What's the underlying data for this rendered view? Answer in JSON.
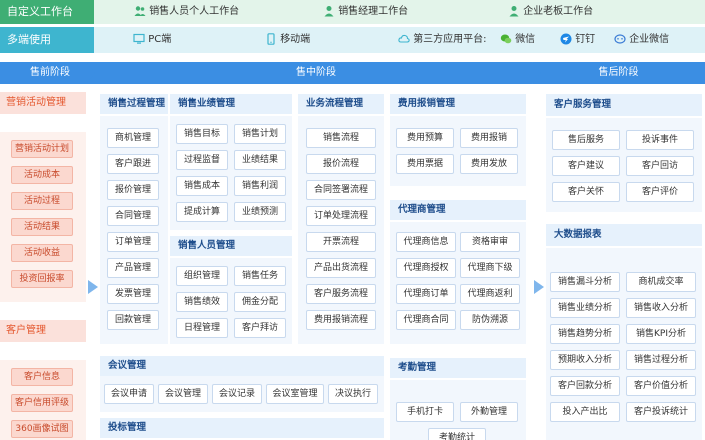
{
  "row1": {
    "label": "自定义工作台",
    "items": [
      "销售人员个人工作台",
      "销售经理工作台",
      "企业老板工作台"
    ]
  },
  "row2": {
    "label": "多端使用",
    "pc": "PC端",
    "mobile": "移动端",
    "third": "第三方应用平台:",
    "wechat": "微信",
    "dingtalk": "钉钉",
    "wework": "企业微信"
  },
  "stages": {
    "pre": "售前阶段",
    "mid": "售中阶段",
    "post": "售后阶段"
  },
  "pre": {
    "marketing": {
      "title": "营销活动管理",
      "items": [
        "营销活动计划",
        "活动成本",
        "活动过程",
        "活动结果",
        "活动收益",
        "投资回报率"
      ]
    },
    "customer": {
      "title": "客户管理",
      "items": [
        "客户信息",
        "客户信用评级",
        "360画像试图"
      ]
    }
  },
  "mid": {
    "sales_process": {
      "title": "销售过程管理",
      "items": [
        "商机管理",
        "客户跟进",
        "报价管理",
        "合同管理",
        "订单管理",
        "产品管理",
        "发票管理",
        "回款管理"
      ]
    },
    "performance": {
      "title": "销售业绩管理",
      "items": [
        "销售目标",
        "销售计划",
        "过程监督",
        "业绩结果",
        "销售成本",
        "销售利润",
        "提成计算",
        "业绩预测"
      ]
    },
    "staff": {
      "title": "销售人员管理",
      "items": [
        "组织管理",
        "销售任务",
        "销售绩效",
        "佣金分配",
        "日程管理",
        "客户拜访"
      ]
    },
    "workflow": {
      "title": "业务流程管理",
      "items": [
        "销售流程",
        "报价流程",
        "合同签署流程",
        "订单处理流程",
        "开票流程",
        "产品出货流程",
        "客户服务流程",
        "费用报销流程"
      ]
    },
    "expense": {
      "title": "费用报销管理",
      "items": [
        "费用预算",
        "费用报销",
        "费用票据",
        "费用发放"
      ]
    },
    "agent": {
      "title": "代理商管理",
      "items": [
        "代理商信息",
        "资格审审",
        "代理商授权",
        "代理商下级",
        "代理商订单",
        "代理商返利",
        "代理商合同",
        "防伪溯源"
      ]
    },
    "meeting": {
      "title": "会议管理",
      "items": [
        "会议申请",
        "会议管理",
        "会议记录",
        "会议室管理",
        "决议执行"
      ]
    },
    "attendance": {
      "title": "考勤管理",
      "items": [
        "手机打卡",
        "外勤管理",
        "考勤统计"
      ]
    },
    "bidding": {
      "title": "投标管理"
    }
  },
  "post": {
    "service": {
      "title": "客户服务管理",
      "items": [
        "售后服务",
        "投诉事件",
        "客户建议",
        "客户回访",
        "客户关怀",
        "客户评价"
      ]
    },
    "bigdata": {
      "title": "大数据报表",
      "items": [
        "销售漏斗分析",
        "商机成交率",
        "销售业绩分析",
        "销售收入分析",
        "销售趋势分析",
        "销售KPI分析",
        "预期收入分析",
        "销售过程分析",
        "客户回款分析",
        "客户价值分析",
        "投入产出比",
        "客户投诉统计"
      ]
    }
  },
  "colors": {
    "green": "#3fae74",
    "teal": "#3eb5cf",
    "blue": "#3b8ee3",
    "pink": "#e4572e"
  }
}
